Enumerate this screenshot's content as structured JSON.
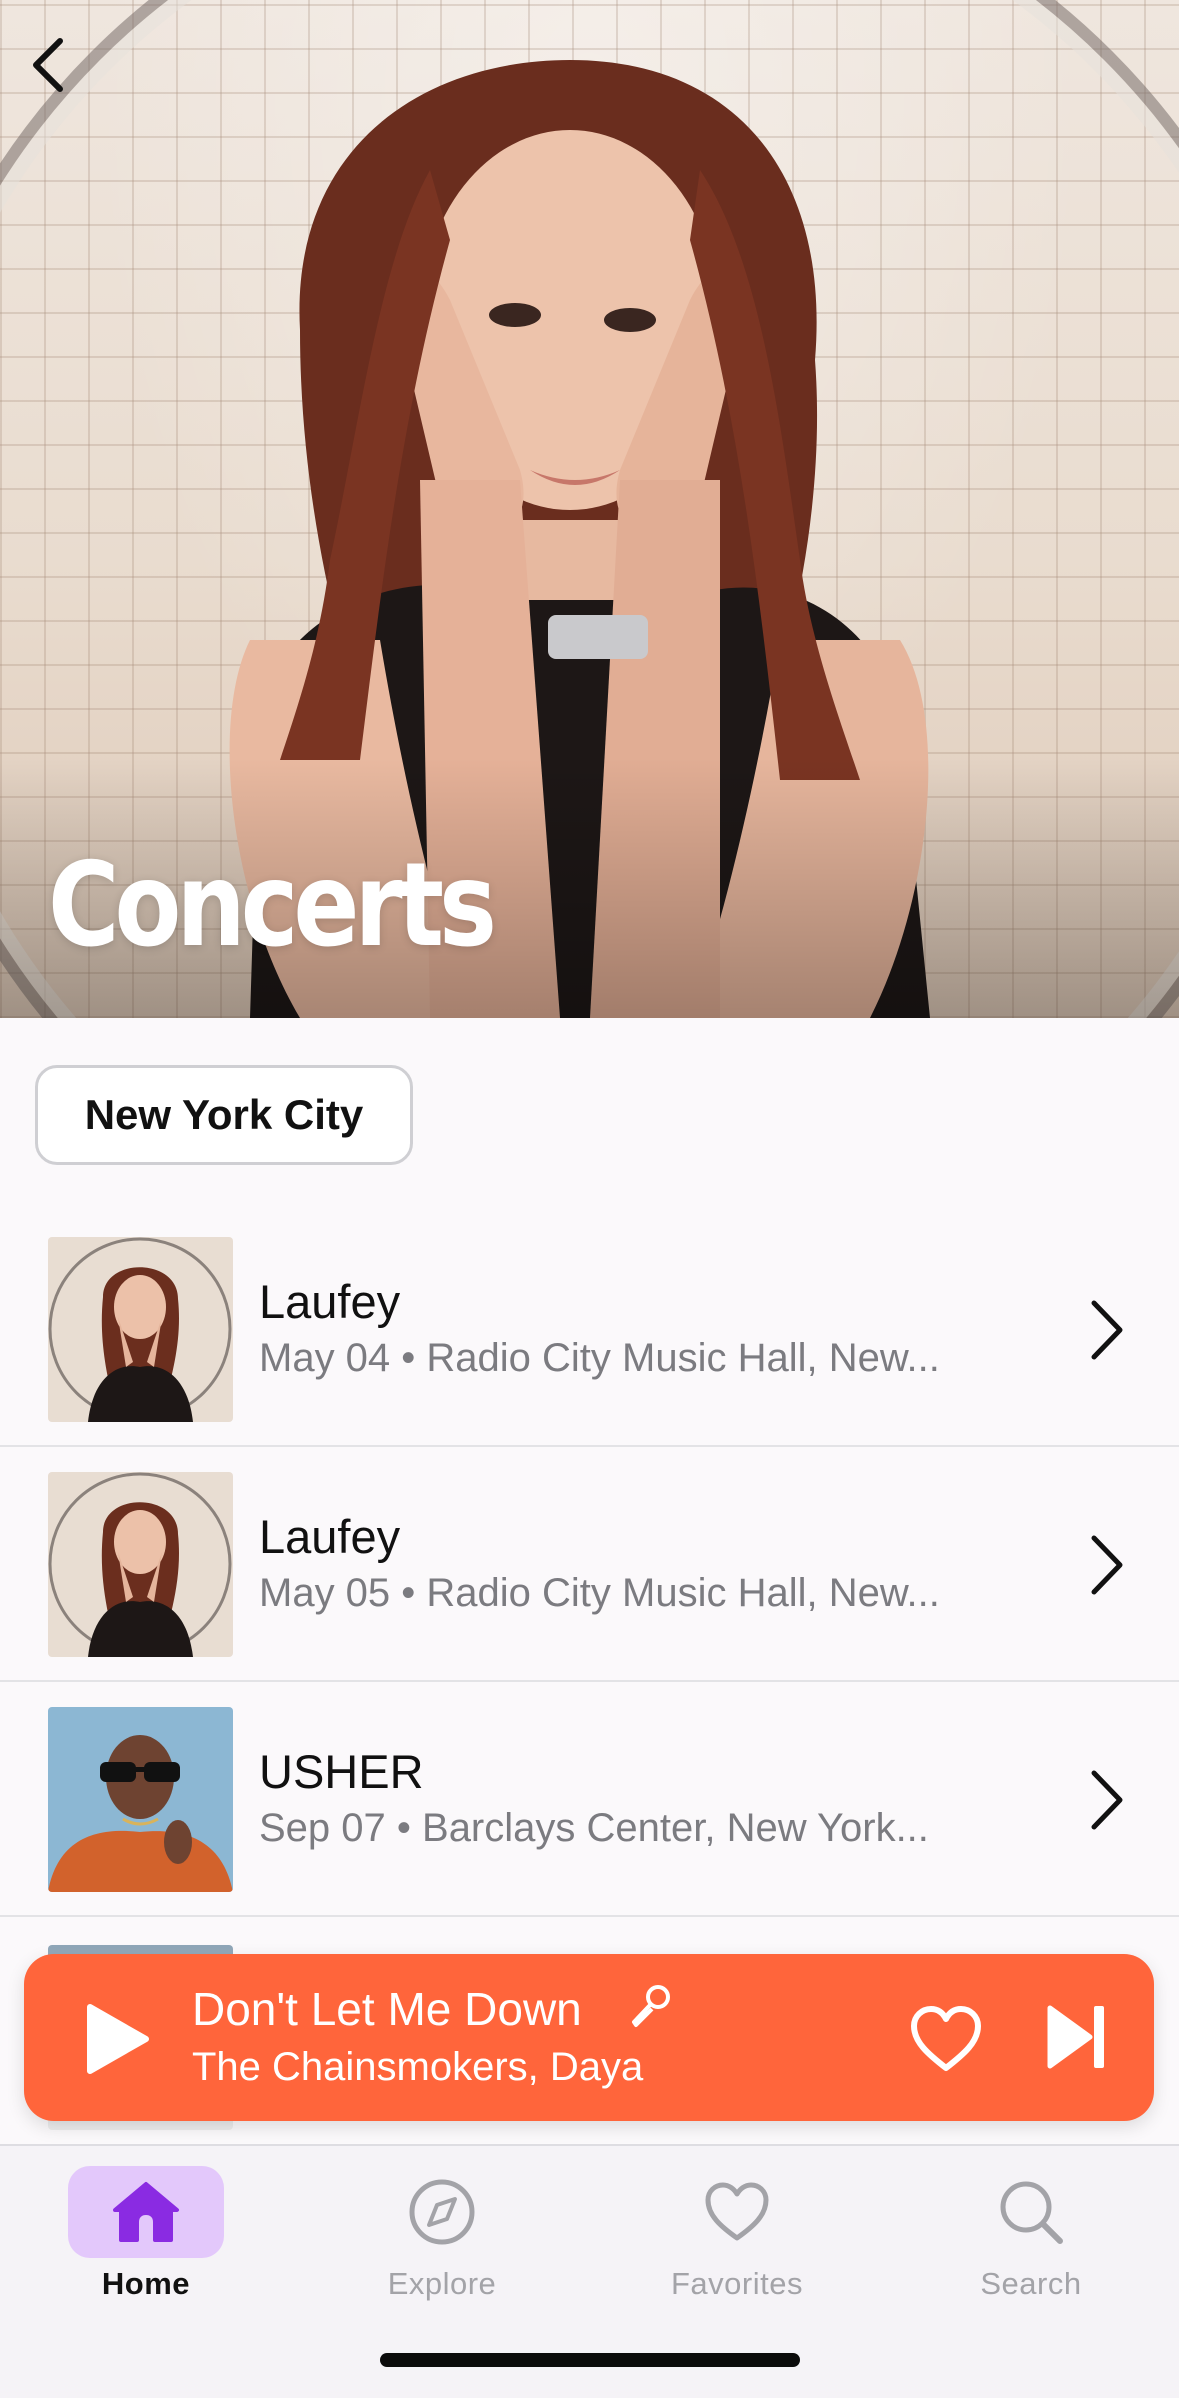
{
  "header": {
    "title": "Concerts",
    "back_icon": "chevron-left-icon"
  },
  "location": {
    "label": "New York City"
  },
  "concerts": [
    {
      "artist": "Laufey",
      "details": "May 04 • Radio City Music Hall, New...",
      "thumb": "laufey-photo"
    },
    {
      "artist": "Laufey",
      "details": "May 05 • Radio City Music Hall, New...",
      "thumb": "laufey-photo"
    },
    {
      "artist": "USHER",
      "details": "Sep 07 • Barclays Center, New York...",
      "thumb": "usher-photo"
    }
  ],
  "now_playing": {
    "title": "Don't Let Me Down",
    "artist": "The Chainsmokers, Daya",
    "color": "#ff653b",
    "icons": [
      "play-icon",
      "microphone-icon",
      "heart-icon",
      "next-track-icon"
    ]
  },
  "tabs": [
    {
      "label": "Home",
      "icon": "house-icon",
      "active": true
    },
    {
      "label": "Explore",
      "icon": "compass-icon",
      "active": false
    },
    {
      "label": "Favorites",
      "icon": "heart-icon",
      "active": false
    },
    {
      "label": "Search",
      "icon": "search-icon",
      "active": false
    }
  ],
  "colors": {
    "accent": "#ff653b",
    "tab_active_bg": "#e3c8fb",
    "tab_active_icon": "#8a2be2",
    "tab_inactive": "#a3a3a8"
  }
}
